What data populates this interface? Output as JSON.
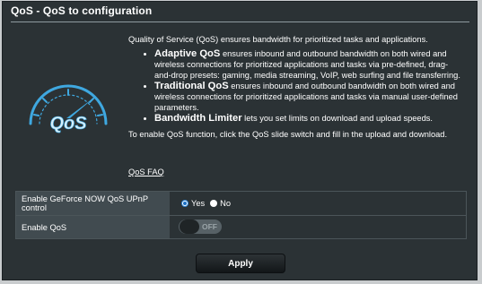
{
  "title": "QoS - QoS to configuration",
  "description": {
    "intro": "Quality of Service (QoS) ensures bandwidth for prioritized tasks and applications.",
    "items": [
      {
        "name": "Adaptive QoS",
        "text": " ensures inbound and outbound bandwidth on both wired and wireless connections for prioritized applications and tasks via pre-defined, drag-and-drop presets: gaming, media streaming, VoIP, web surfing and file transferring."
      },
      {
        "name": "Traditional QoS",
        "text": " ensures inbound and outbound bandwidth on both wired and wireless connections for prioritized applications and tasks via manual user-defined parameters."
      },
      {
        "name": "Bandwidth Limiter",
        "text": " lets you set limits on download and upload speeds."
      }
    ],
    "instruction": "To enable QoS function, click the QoS slide switch and fill in the upload and download."
  },
  "faq_link": "QoS FAQ",
  "logo": {
    "text": "QoS",
    "icon": "speedometer-qos-logo"
  },
  "settings": {
    "geforce_label": "Enable GeForce NOW QoS UPnP control",
    "geforce_options": [
      "Yes",
      "No"
    ],
    "geforce_selected": "Yes",
    "qos_label": "Enable QoS",
    "qos_state": "OFF"
  },
  "apply_label": "Apply",
  "colors": {
    "background": "#2b3235",
    "label_cell": "#414b50",
    "radio_selected": "#1b6fc4",
    "logo_blue": "#3fa8e0"
  }
}
